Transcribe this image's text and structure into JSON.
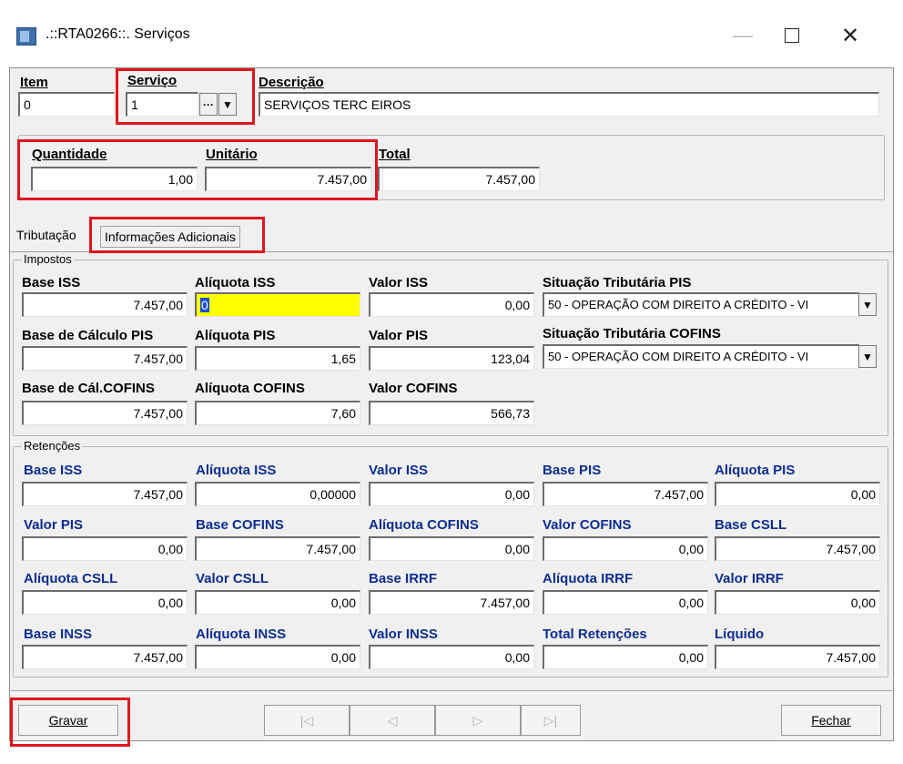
{
  "window": {
    "title": ".::RTA0266::. Serviços",
    "minimize_glyph": "—",
    "close_glyph": "✕"
  },
  "header": {
    "item_label": "Item",
    "item_value": "0",
    "servico_label": "Serviço",
    "servico_value": "1",
    "servico_ellipsis": "···",
    "descricao_label": "Descrição",
    "descricao_value": "SERVIÇOS TERC EIROS",
    "quantidade_label": "Quantidade",
    "quantidade_value": "1,00",
    "unitario_label": "Unitário",
    "unitario_value": "7.457,00",
    "total_label": "Total",
    "total_value": "7.457,00"
  },
  "tabs": [
    "Tributação",
    "Informações Adicionais"
  ],
  "impostos": {
    "title": "Impostos",
    "base_iss_label": "Base ISS",
    "base_iss_value": "7.457,00",
    "aliquota_iss_label": "Alíquota ISS",
    "aliquota_iss_value": "0",
    "valor_iss_label": "Valor ISS",
    "valor_iss_value": "0,00",
    "sit_pis_label": "Situação Tributária PIS",
    "sit_pis_value": "50 - OPERAÇÃO COM DIREITO A CRÉDITO - VI",
    "base_calc_pis_label": "Base de Cálculo PIS",
    "base_calc_pis_value": "7.457,00",
    "aliquota_pis_label": "Alíquota PIS",
    "aliquota_pis_value": "1,65",
    "valor_pis_label": "Valor PIS",
    "valor_pis_value": "123,04",
    "sit_cofins_label": "Situação Tributária COFINS",
    "sit_cofins_value": "50 - OPERAÇÃO COM DIREITO A CRÉDITO - VI",
    "base_cal_cofins_label": "Base de Cál.COFINS",
    "base_cal_cofins_value": "7.457,00",
    "aliquota_cofins_label": "Alíquota COFINS",
    "aliquota_cofins_value": "7,60",
    "valor_cofins_label": "Valor COFINS",
    "valor_cofins_value": "566,73"
  },
  "retencoes": {
    "title": "Retenções",
    "rows": [
      [
        {
          "label": "Base ISS",
          "value": "7.457,00"
        },
        {
          "label": "Alíquota ISS",
          "value": "0,00000"
        },
        {
          "label": "Valor ISS",
          "value": "0,00"
        },
        {
          "label": "Base PIS",
          "value": "7.457,00"
        },
        {
          "label": "Alíquota PIS",
          "value": "0,00"
        }
      ],
      [
        {
          "label": "Valor PIS",
          "value": "0,00"
        },
        {
          "label": "Base COFINS",
          "value": "7.457,00"
        },
        {
          "label": "Alíquota COFINS",
          "value": "0,00"
        },
        {
          "label": "Valor COFINS",
          "value": "0,00"
        },
        {
          "label": "Base CSLL",
          "value": "7.457,00"
        }
      ],
      [
        {
          "label": "Alíquota CSLL",
          "value": "0,00"
        },
        {
          "label": "Valor CSLL",
          "value": "0,00"
        },
        {
          "label": "Base IRRF",
          "value": "7.457,00"
        },
        {
          "label": "Alíquota IRRF",
          "value": "0,00"
        },
        {
          "label": "Valor IRRF",
          "value": "0,00"
        }
      ],
      [
        {
          "label": "Base INSS",
          "value": "7.457,00"
        },
        {
          "label": "Alíquota INSS",
          "value": "0,00"
        },
        {
          "label": "Valor INSS",
          "value": "0,00"
        },
        {
          "label": "Total Retenções",
          "value": "0,00"
        },
        {
          "label": "Líquido",
          "value": "7.457,00"
        }
      ]
    ]
  },
  "footer": {
    "gravar_label": "Gravar",
    "fechar_label": "Fechar",
    "nav_first": "|◁",
    "nav_prev": "◁",
    "nav_next": "▷",
    "nav_last": "▷|"
  },
  "colors": {
    "highlight_box": "#e0141e",
    "retencoes_label": "#0d2d91",
    "active_field": "#ffff00"
  },
  "icons": [
    "app-icon",
    "minimize-icon",
    "maximize-icon",
    "close-icon",
    "chevron-down-icon",
    "ellipsis-icon"
  ]
}
